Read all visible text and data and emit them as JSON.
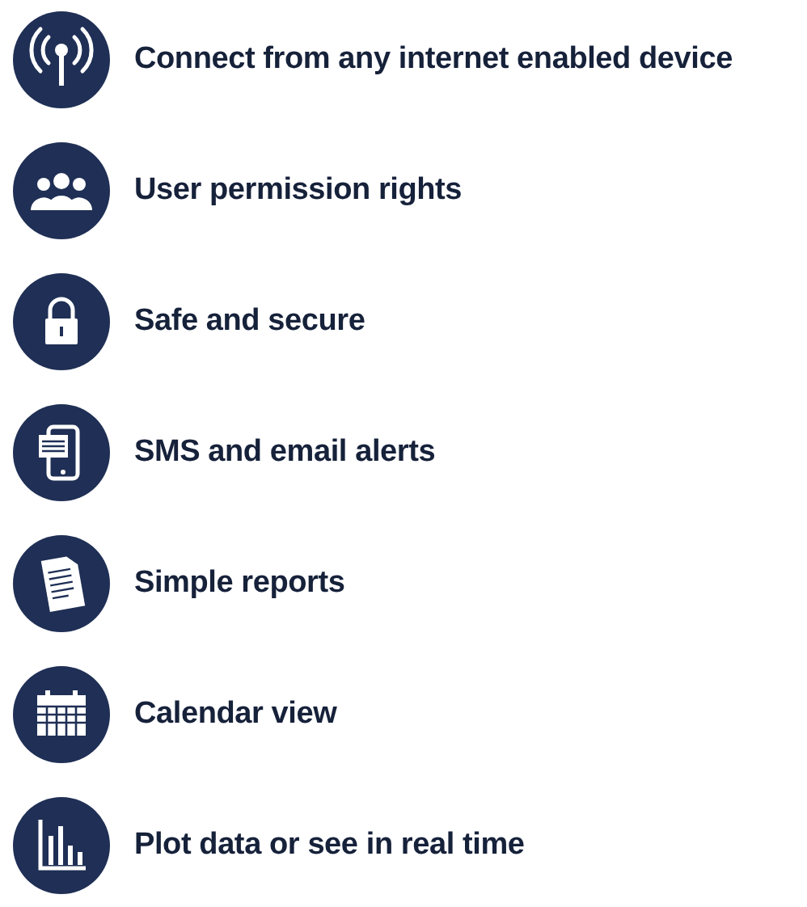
{
  "features": [
    {
      "kind": "signal",
      "label": "Connect from any internet enabled device"
    },
    {
      "kind": "users",
      "label": "User permission rights"
    },
    {
      "kind": "lock",
      "label": "Safe and secure"
    },
    {
      "kind": "phone",
      "label": "SMS and email alerts"
    },
    {
      "kind": "document",
      "label": "Simple reports"
    },
    {
      "kind": "calendar",
      "label": "Calendar view"
    },
    {
      "kind": "chart",
      "label": "Plot data or see in real time"
    }
  ]
}
